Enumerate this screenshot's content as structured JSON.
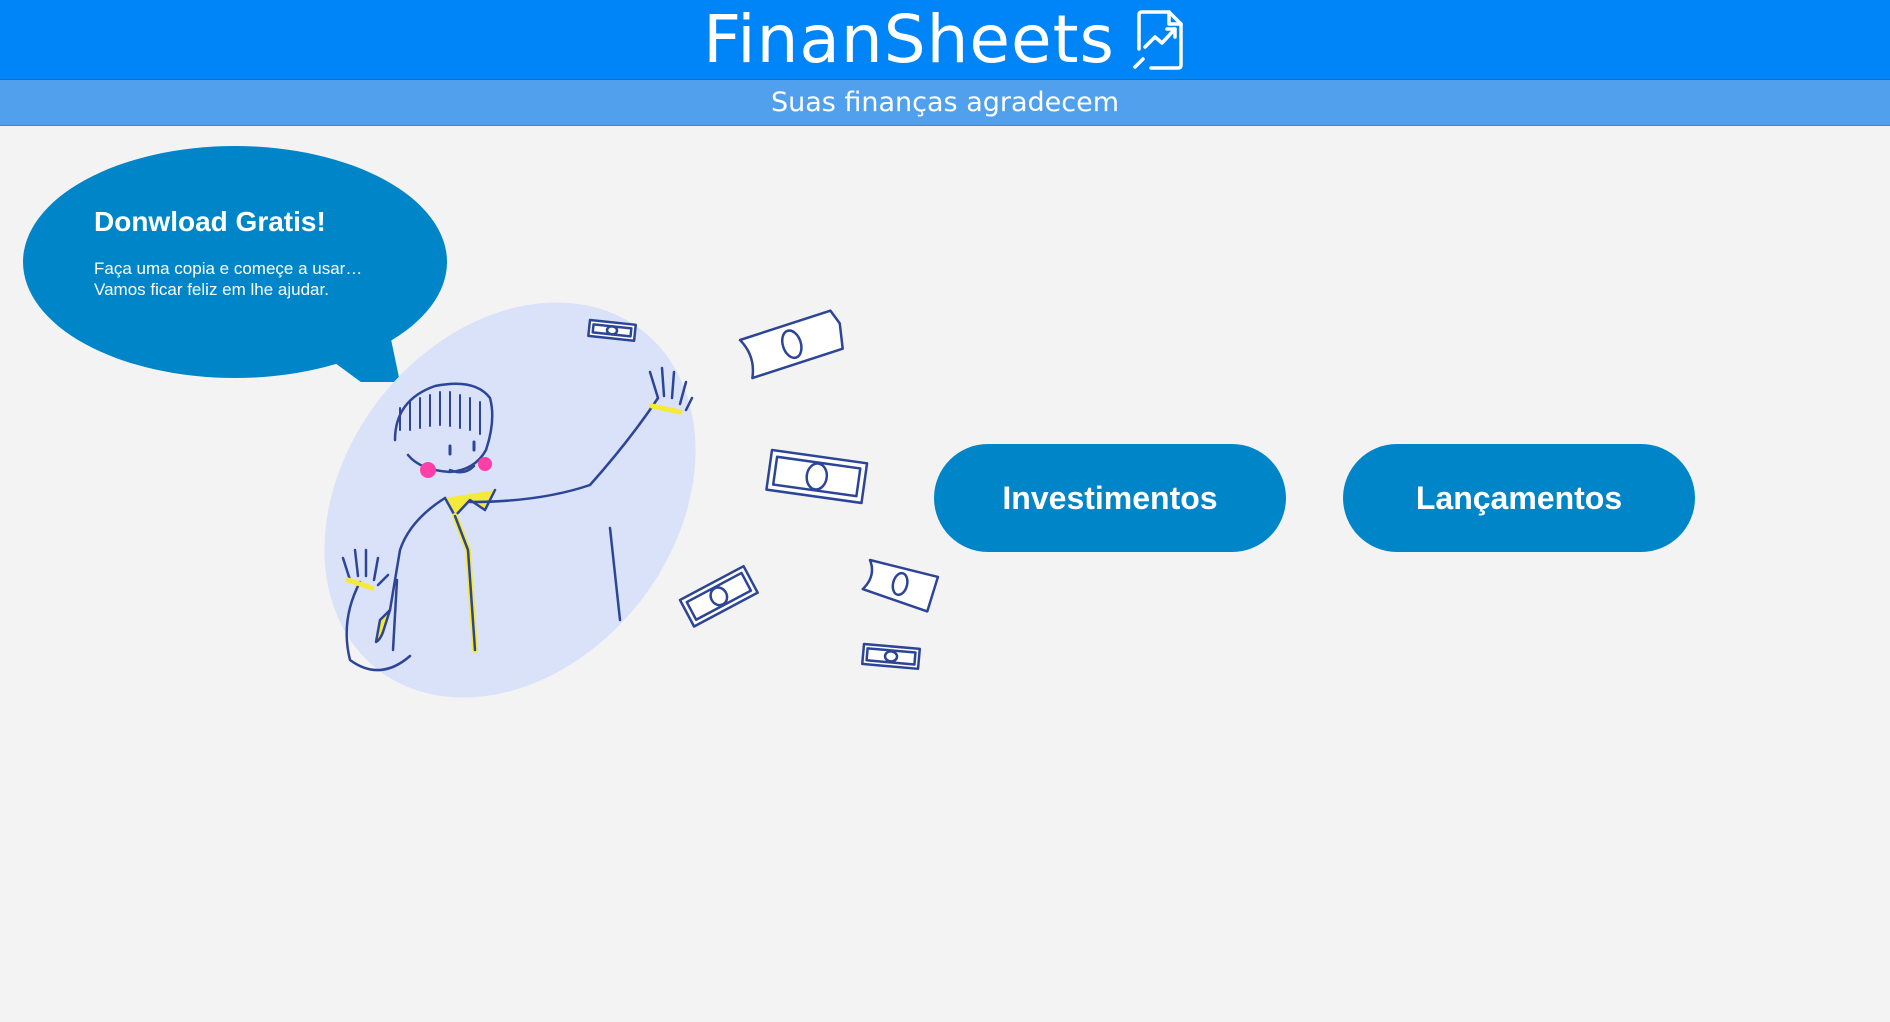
{
  "header": {
    "title": "FinanSheets",
    "icon": "chart-document-icon",
    "tagline": "Suas finanças agradecem",
    "bar_color": "#0085f8",
    "subbar_color": "#50a0ee"
  },
  "promo": {
    "title": "Donwload Gratis!",
    "text": "Faça uma copia e começe a usar… Vamos ficar feliz em lhe ajudar.",
    "color": "#0086c8"
  },
  "illustration": {
    "icon": "person-with-money-illustration"
  },
  "nav": {
    "investimentos_label": "Investimentos",
    "lancamentos_label": "Lançamentos",
    "button_color": "#0086c8"
  }
}
